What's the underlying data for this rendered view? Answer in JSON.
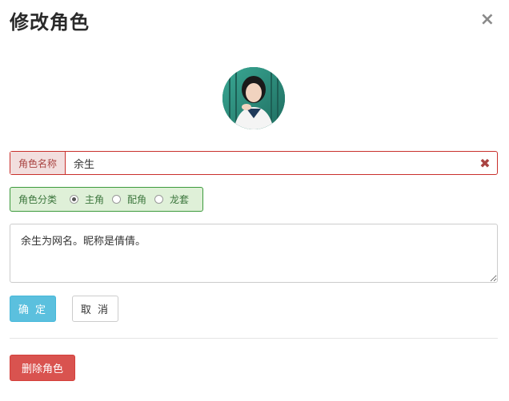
{
  "dialog": {
    "title": "修改角色",
    "close_symbol": "×"
  },
  "name_field": {
    "label": "角色名称",
    "value": "余生",
    "clear_symbol": "✖"
  },
  "category": {
    "label": "角色分类",
    "options": [
      {
        "label": "主角",
        "checked": true
      },
      {
        "label": "配角",
        "checked": false
      },
      {
        "label": "龙套",
        "checked": false
      }
    ]
  },
  "description": {
    "value": "余生为网名。昵称是倩倩。"
  },
  "buttons": {
    "confirm": "确 定",
    "cancel": "取 消",
    "delete": "删除角色"
  },
  "colors": {
    "confirm_bg": "#5bc0de",
    "delete_bg": "#d9534f",
    "error_border": "#c9302c",
    "success_bg": "#dff0d8"
  },
  "icons": {
    "close": "close-icon",
    "clear": "clear-icon",
    "avatar": "avatar-image"
  }
}
